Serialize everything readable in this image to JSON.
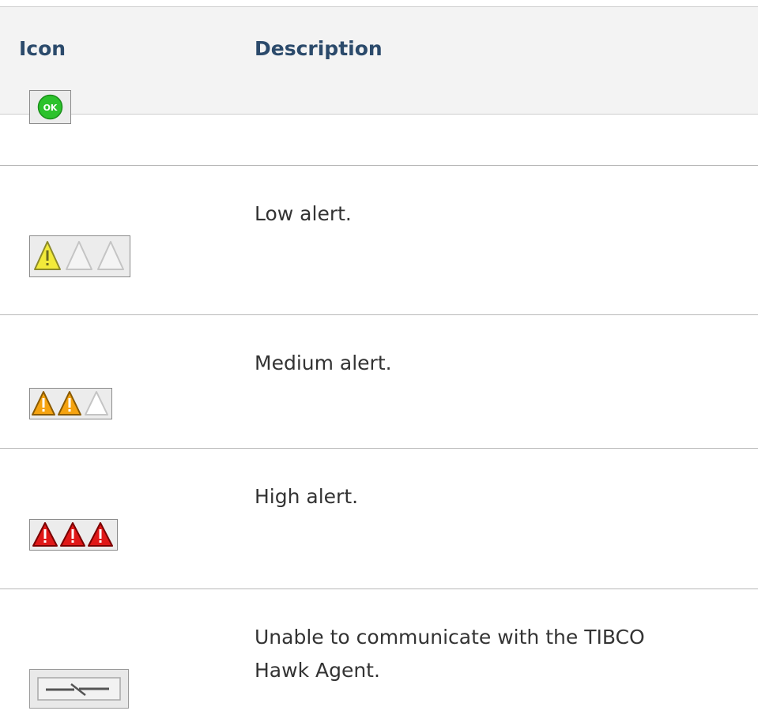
{
  "header": {
    "icon_label": "Icon",
    "description_label": "Description"
  },
  "rows": [
    {
      "icon": "ok-status-icon",
      "description": ""
    },
    {
      "icon": "low-alert-icon",
      "description": "Low alert."
    },
    {
      "icon": "medium-alert-icon",
      "description": "Medium alert."
    },
    {
      "icon": "high-alert-icon",
      "description": "High alert."
    },
    {
      "icon": "disconnected-icon",
      "description": "Unable to communicate with the TIBCO Hawk Agent."
    }
  ],
  "icon_text": {
    "ok": "OK"
  },
  "colors": {
    "header_text": "#2b4a6b",
    "ok_green": "#2cc22c",
    "low_yellow": "#f2ea3a",
    "medium_orange": "#f5a310",
    "high_red": "#e01818"
  }
}
